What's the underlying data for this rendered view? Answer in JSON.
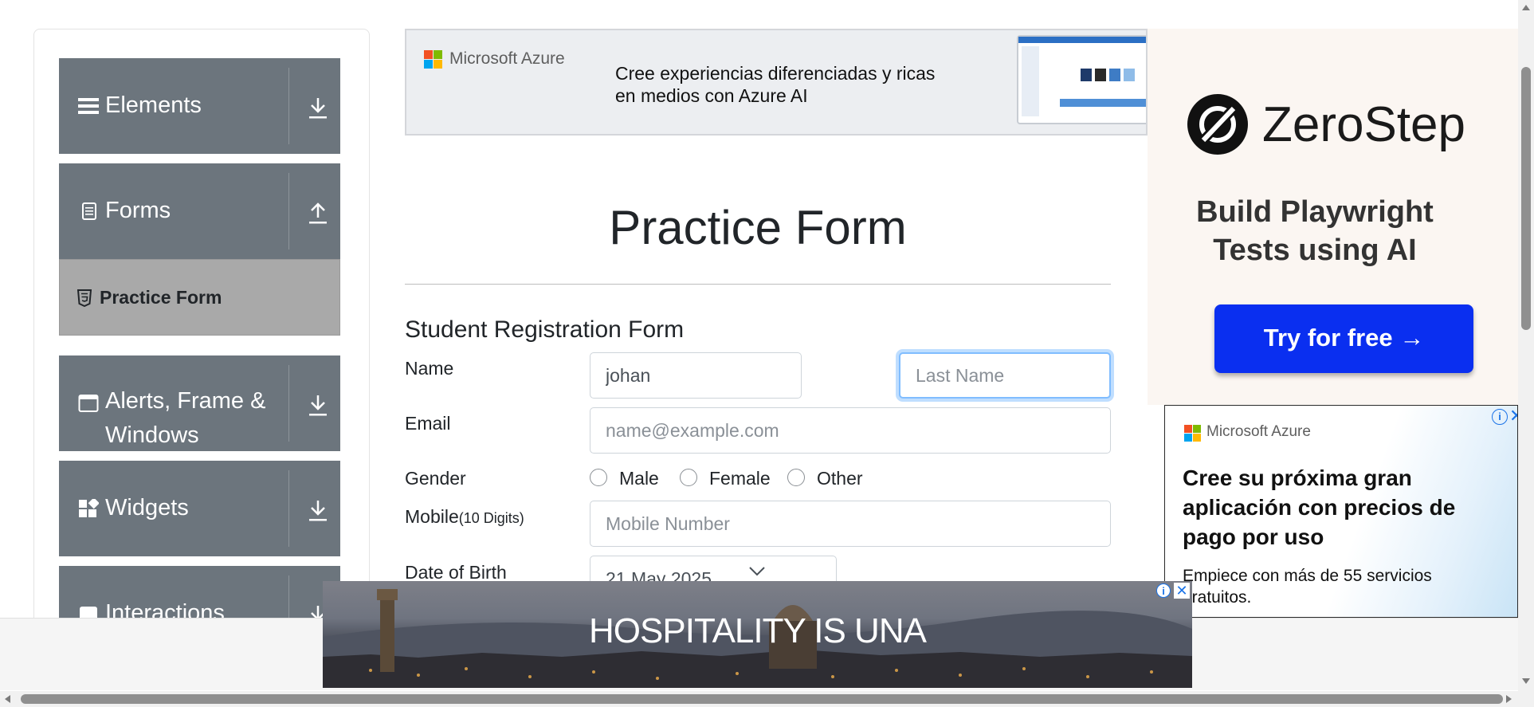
{
  "sidebar": {
    "groups": [
      {
        "label": "Elements",
        "icon": "hamburger-icon",
        "toggle": "download-arrow-icon"
      },
      {
        "label": "Forms",
        "icon": "document-icon",
        "toggle": "upload-arrow-icon",
        "expanded": true
      },
      {
        "label": "Alerts, Frame &",
        "label_line2": "Windows",
        "icon": "window-icon",
        "toggle": "download-arrow-icon"
      },
      {
        "label": "Widgets",
        "icon": "widgets-icon",
        "toggle": "download-arrow-icon"
      },
      {
        "label": "Interactions",
        "icon": "interactions-icon",
        "toggle": "download-arrow-icon"
      }
    ],
    "active_item": {
      "label": "Practice Form",
      "icon": "html5-icon"
    }
  },
  "top_ad": {
    "brand": "Microsoft Azure",
    "line1": "Cree experiencias diferenciadas y ricas",
    "line2": "en medios con Azure AI"
  },
  "right_ad": {
    "brand": "ZeroStep",
    "headline1": "Build Playwright",
    "headline2": "Tests using AI",
    "cta": "Try for free →",
    "button_color": "#0a2ff0"
  },
  "right_ad2": {
    "brand": "Microsoft Azure",
    "headline1": "Cree su próxima gran",
    "headline2": "aplicación con precios de",
    "headline3": "pago por uso",
    "sub1": "Empiece con más de 55 servicios",
    "sub2": "gratuitos."
  },
  "page": {
    "title": "Practice Form",
    "form_heading": "Student Registration Form"
  },
  "form": {
    "name_label": "Name",
    "first_name_value": "johan",
    "last_name_placeholder": "Last Name",
    "email_label": "Email",
    "email_placeholder": "name@example.com",
    "gender_label": "Gender",
    "gender_options": [
      "Male",
      "Female",
      "Other"
    ],
    "mobile_label": "Mobile",
    "mobile_hint": "(10 Digits)",
    "mobile_placeholder": "Mobile Number",
    "dob_label": "Date of Birth",
    "dob_value": "21 May 2025"
  },
  "bottom_ad": {
    "text": "HOSPITALITY IS UNA"
  },
  "colors": {
    "sidebar_header": "#6c757d",
    "active_item_bg": "#a9a9a9",
    "focus_border": "#80bdff"
  }
}
